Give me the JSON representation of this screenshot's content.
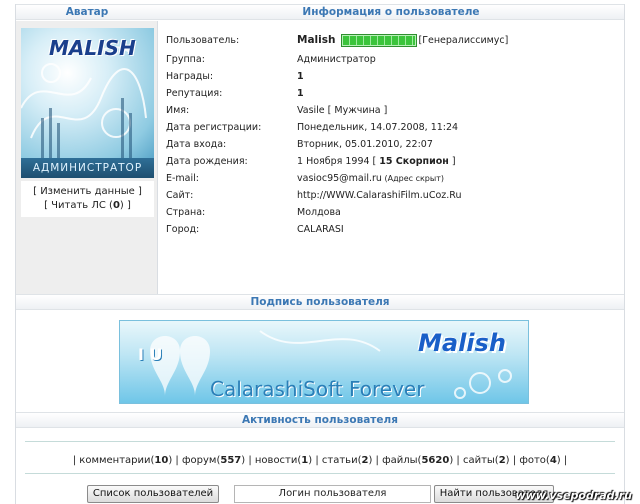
{
  "headers": {
    "avatar": "Аватар",
    "info": "Информация о пользователе",
    "signature": "Подпись пользователя",
    "activity": "Активность пользователя"
  },
  "avatar": {
    "logo_text": "MALISH",
    "role_banner": "АДМИНИСТРАТОР",
    "link_edit": "[ Изменить данные ]",
    "link_pm_prefix": "[ Читать ЛС (",
    "link_pm_count": "0",
    "link_pm_suffix": ") ]"
  },
  "profile": {
    "rows": [
      {
        "label": "Пользователь:",
        "value": "Malish"
      },
      {
        "label": "Группа:",
        "value": "Администратор"
      },
      {
        "label": "Награды:",
        "value": "1"
      },
      {
        "label": "Репутация:",
        "value": "1"
      },
      {
        "label": "Имя:",
        "value": "Vasile [ Мужчина ]"
      },
      {
        "label": "Дата регистрации:",
        "value": "Понедельник, 14.07.2008, 11:24"
      },
      {
        "label": "Дата входа:",
        "value": "Вторник, 05.01.2010, 22:07"
      },
      {
        "label": "Дата рождения:",
        "value": "1 Ноября 1994 [ ",
        "value_bold": "15 Скорпион",
        "value_tail": " ]"
      },
      {
        "label": "E-mail:",
        "value": "vasioc95@mail.ru",
        "value_note": " (Адрес скрыт)"
      },
      {
        "label": "Сайт:",
        "value": "http://WWW.CalarashiFilm.uCoz.Ru"
      },
      {
        "label": "Страна:",
        "value": "Молдова"
      },
      {
        "label": "Город:",
        "value": "CALARASI"
      }
    ],
    "rank_label": "[Генералиссимус]",
    "rank_progress": 1.0
  },
  "signature": {
    "banner_text": "CalarashiSoft Forever",
    "banner_logo": "Malish",
    "banner_iu": "I U"
  },
  "activity": {
    "items": [
      {
        "name": "комментарии",
        "count": "10"
      },
      {
        "name": "форум",
        "count": "557"
      },
      {
        "name": "новости",
        "count": "1"
      },
      {
        "name": "статьи",
        "count": "2"
      },
      {
        "name": "файлы",
        "count": "5620"
      },
      {
        "name": "сайты",
        "count": "2"
      },
      {
        "name": "фото",
        "count": "4"
      }
    ]
  },
  "buttons": {
    "user_list": "Список пользователей",
    "login_placeholder": "Логин пользователя",
    "find_user": "Найти пользователя"
  },
  "watermark": "www.vsepodrad.ru",
  "colors": {
    "header_text": "#3c78b4",
    "rank_bar": "#3cc43c"
  }
}
